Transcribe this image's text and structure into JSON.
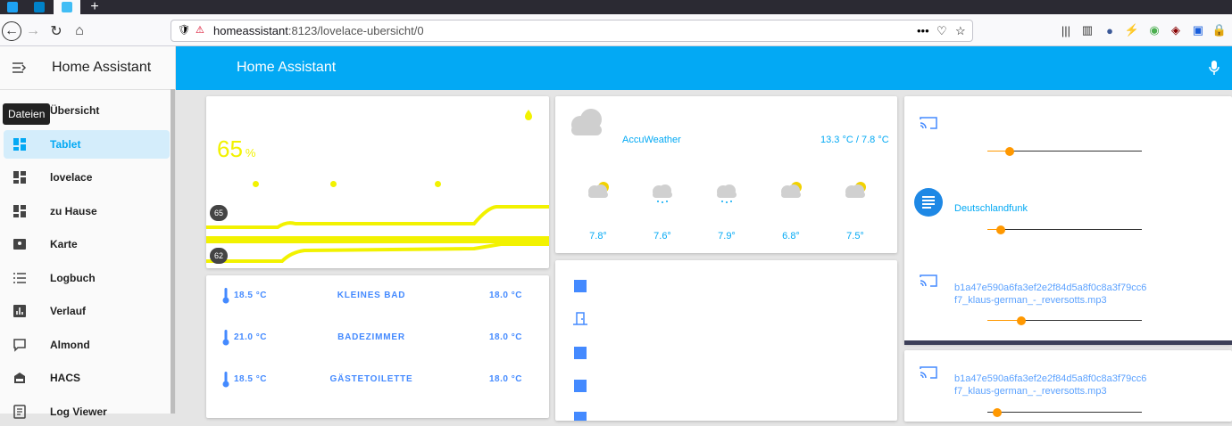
{
  "browser": {
    "url_host": "homeassistant",
    "url_path": ":8123/lovelace-ubersicht/0",
    "tabs": [
      "twitter-icon",
      "nextcloud-icon",
      "home-assistant-icon"
    ]
  },
  "sidebar": {
    "title": "Home Assistant",
    "tooltip": "Dateien",
    "items": [
      {
        "label": "Übersicht",
        "icon": "dashboard-icon",
        "selected": false
      },
      {
        "label": "Tablet",
        "icon": "dashboard-icon",
        "selected": true
      },
      {
        "label": "lovelace",
        "icon": "dashboard-icon",
        "selected": false
      },
      {
        "label": "zu Hause",
        "icon": "dashboard-icon",
        "selected": false
      },
      {
        "label": "Karte",
        "icon": "map-icon",
        "selected": false
      },
      {
        "label": "Logbuch",
        "icon": "list-icon",
        "selected": false
      },
      {
        "label": "Verlauf",
        "icon": "chart-icon",
        "selected": false
      },
      {
        "label": "Almond",
        "icon": "chat-icon",
        "selected": false
      },
      {
        "label": "HACS",
        "icon": "hacs-icon",
        "selected": false
      },
      {
        "label": "Log Viewer",
        "icon": "document-icon",
        "selected": false
      }
    ]
  },
  "header": {
    "title": "Home Assistant"
  },
  "humidity": {
    "value": "65",
    "unit": "%",
    "ticks": [
      "65",
      "62"
    ]
  },
  "climate": {
    "rows": [
      {
        "current": "18.5 °C",
        "room": "KLEINES BAD",
        "target": "18.0 °C"
      },
      {
        "current": "21.0 °C",
        "room": "BADEZIMMER",
        "target": "18.0 °C"
      },
      {
        "current": "18.5 °C",
        "room": "GÄSTETOILETTE",
        "target": "18.0 °C"
      }
    ]
  },
  "weather": {
    "provider": "AccuWeather",
    "temps": "13.3 °C / 7.8 °C",
    "forecast": [
      "7.8°",
      "7.6°",
      "7.9°",
      "6.8°",
      "7.5°"
    ]
  },
  "media": {
    "station": "Deutschlandfunk",
    "track": "b1a47e590a6fa3ef2e2f84d5a8f0c8a3f79cc6 f7_klaus-german_-_reversotts.mp3",
    "track2": "b1a47e590a6fa3ef2e2f84d5a8f0c8a3f79cc6 f7_klaus-german_-_reversotts.mp3"
  },
  "colors": {
    "accent": "#03a9f4",
    "humidity": "#f2f200",
    "slider": "#ff9800",
    "entity": "#448aff"
  }
}
